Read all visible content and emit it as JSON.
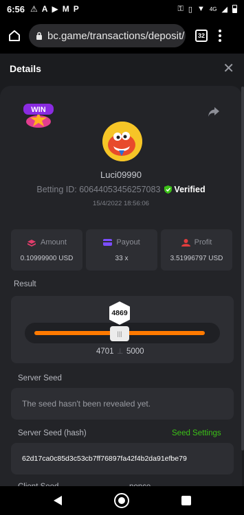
{
  "status_bar": {
    "time": "6:56",
    "left_icons": [
      "warning-icon",
      "font-icon",
      "play-icon",
      "gmail-icon",
      "p-icon"
    ],
    "right_icons": [
      "key-icon",
      "vibrate-icon",
      "wifi-icon",
      "signal-icon",
      "battery-icon"
    ],
    "network": "4G"
  },
  "browser": {
    "url": "bc.game/transactions/deposit/",
    "tab_count": "32"
  },
  "header": {
    "title": "Details"
  },
  "bet": {
    "badge_text": "WIN",
    "username": "Luci09990",
    "betting_id_label": "Betting ID: 60644053456257083",
    "verified_label": "Verified",
    "time": "15/4/2022 18:56:06"
  },
  "stats": [
    {
      "label": "Amount",
      "value": "0.10999900 USD",
      "icon": "coins-icon"
    },
    {
      "label": "Payout",
      "value": "33 x",
      "icon": "card-icon"
    },
    {
      "label": "Profit",
      "value": "3.51996797 USD",
      "icon": "profit-icon"
    }
  ],
  "result": {
    "label": "Result",
    "value": "4869",
    "slider_fraction": 0.97,
    "range_low": "4701",
    "range_high": "5000"
  },
  "server_seed": {
    "label": "Server Seed",
    "value": "The seed hasn't been revealed yet."
  },
  "server_seed_hash": {
    "label": "Server Seed (hash)",
    "value": "62d17ca0c85d3c53cb7ff76897fa42f4b2da91efbe79",
    "action": "Seed Settings"
  },
  "client_seed": {
    "label": "Client Seed",
    "nonce_label": "nonce"
  },
  "colors": {
    "accent": "#ff7a00",
    "verified": "#3bc117",
    "panel": "#232428",
    "card": "#2d2e33"
  }
}
